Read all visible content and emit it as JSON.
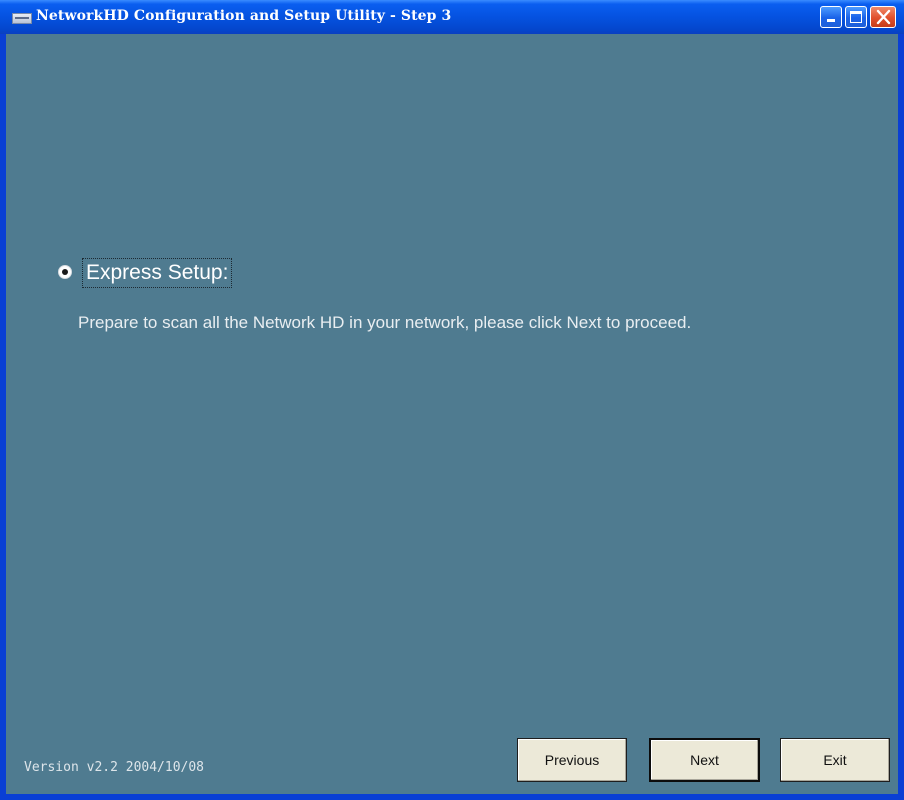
{
  "window": {
    "title": "NetworkHD Configuration and Setup Utility - Step 3"
  },
  "setup": {
    "option_label": "Express Setup:",
    "option_selected": true,
    "description": "Prepare to scan all the Network HD in your network, please click Next to proceed."
  },
  "footer": {
    "version": "Version v2.2  2004/10/08"
  },
  "buttons": {
    "previous": "Previous",
    "next": "Next",
    "exit": "Exit"
  },
  "colors": {
    "titlebar": "#0552e0",
    "client_background": "#4f7b90",
    "button_face": "#ece9d8",
    "close_button": "#e0502c"
  },
  "icons": {
    "app": "window-icon",
    "minimize": "minimize-icon",
    "maximize": "maximize-icon",
    "close": "close-icon"
  }
}
